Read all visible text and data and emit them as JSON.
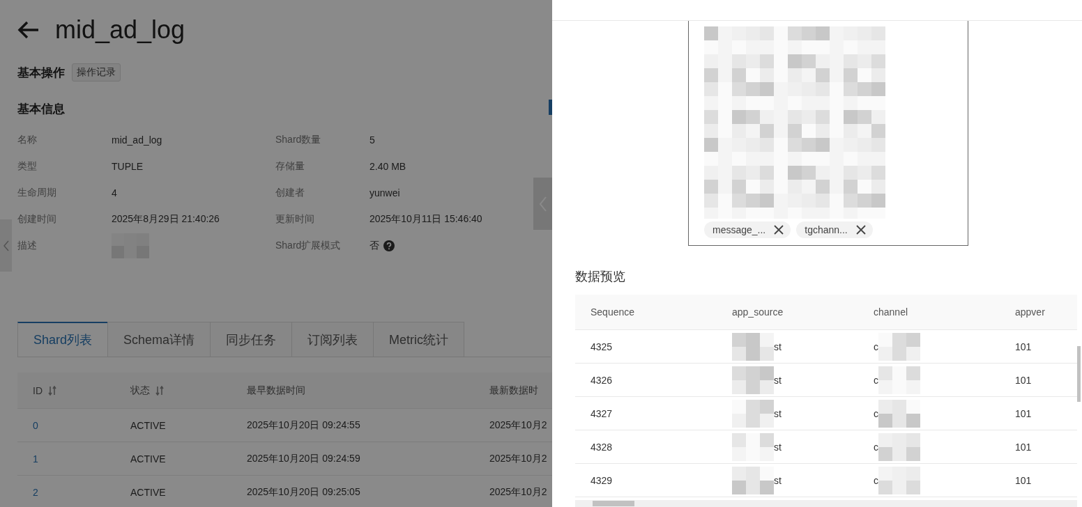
{
  "page": {
    "title": "mid_ad_log",
    "operations": {
      "heading": "基本操作",
      "button": "操作记录"
    },
    "info": {
      "heading": "基本信息",
      "fields": [
        {
          "label": "名称",
          "value": "mid_ad_log",
          "kind": "text"
        },
        {
          "label": "Shard数量",
          "value": "5",
          "kind": "text"
        },
        {
          "label": "类型",
          "value": "TUPLE",
          "kind": "text"
        },
        {
          "label": "存储量",
          "value": "2.40 MB",
          "kind": "text"
        },
        {
          "label": "生命周期",
          "value": "4",
          "kind": "text"
        },
        {
          "label": "创建者",
          "value": "yunwei",
          "kind": "text"
        },
        {
          "label": "创建时间",
          "value": "2025年8月29日 21:40:26",
          "kind": "text"
        },
        {
          "label": "更新时间",
          "value": "2025年10月11日 15:46:40",
          "kind": "text"
        },
        {
          "label": "描述",
          "kind": "redacted"
        },
        {
          "label": "Shard扩展模式",
          "value": "否",
          "kind": "help"
        }
      ]
    },
    "tabs": [
      {
        "label": "Shard列表",
        "selected": true
      },
      {
        "label": "Schema详情",
        "selected": false
      },
      {
        "label": "同步任务",
        "selected": false
      },
      {
        "label": "订阅列表",
        "selected": false
      },
      {
        "label": "Metric统计",
        "selected": false
      }
    ],
    "shard_table": {
      "columns": [
        {
          "label": "ID",
          "sortable": true
        },
        {
          "label": "状态",
          "sortable": true
        },
        {
          "label": "最早数据时间",
          "sortable": false
        },
        {
          "label": "最新数据时",
          "sortable": false
        }
      ],
      "rows": [
        {
          "id": "0",
          "status": "ACTIVE",
          "earliest": "2025年10月20日 09:24:55",
          "latest": "2025年10月2"
        },
        {
          "id": "1",
          "status": "ACTIVE",
          "earliest": "2025年10月20日 09:24:59",
          "latest": "2025年10月2"
        },
        {
          "id": "2",
          "status": "ACTIVE",
          "earliest": "2025年10月20日 09:25:05",
          "latest": "2025年10月2"
        }
      ]
    }
  },
  "drawer": {
    "tags": [
      {
        "label": "message_..."
      },
      {
        "label": "tgchann..."
      }
    ],
    "preview": {
      "heading": "数据预览",
      "columns": [
        "Sequence",
        "app_source",
        "channel",
        "appver"
      ],
      "rows": [
        {
          "sequence": "4325",
          "app_source": "st",
          "channel": "c",
          "appver": "101"
        },
        {
          "sequence": "4326",
          "app_source": "st",
          "channel": "c",
          "appver": "101"
        },
        {
          "sequence": "4327",
          "app_source": "st",
          "channel": "c",
          "appver": "101"
        },
        {
          "sequence": "4328",
          "app_source": "st",
          "channel": "c",
          "appver": "101"
        },
        {
          "sequence": "4329",
          "app_source": "st",
          "channel": "c",
          "appver": "101"
        }
      ]
    }
  }
}
